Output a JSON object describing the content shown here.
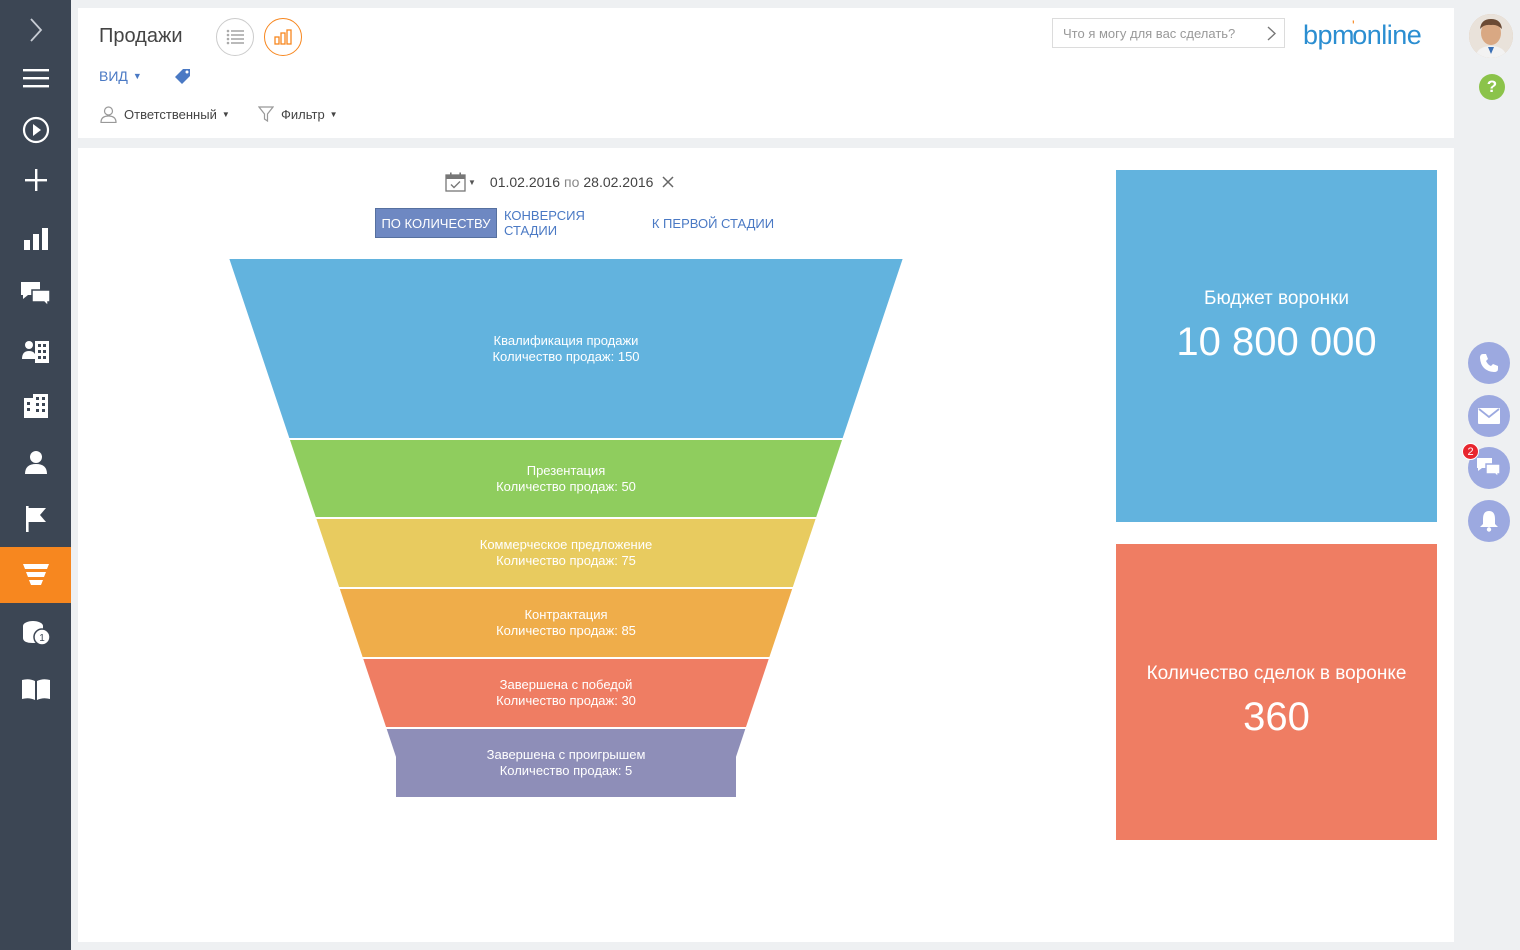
{
  "sidebar": {
    "items": [
      {
        "icon": "chevron-right-icon",
        "active": false
      },
      {
        "icon": "menu-icon",
        "active": false
      },
      {
        "icon": "play-icon",
        "active": false
      },
      {
        "icon": "plus-icon",
        "active": false
      },
      {
        "icon": "bar-chart-icon",
        "active": false
      },
      {
        "icon": "chat-icon",
        "active": false
      },
      {
        "icon": "contacts-icon",
        "active": false
      },
      {
        "icon": "building-icon",
        "active": false
      },
      {
        "icon": "person-icon",
        "active": false
      },
      {
        "icon": "flag-icon",
        "active": false
      },
      {
        "icon": "funnel-icon",
        "active": true
      },
      {
        "icon": "coins-icon",
        "active": false,
        "badge": "1"
      },
      {
        "icon": "book-icon",
        "active": false
      }
    ]
  },
  "header": {
    "title": "Продажи",
    "view_menu": "ВИД",
    "filters": {
      "responsible": "Ответственный",
      "filter": "Фильтр"
    },
    "search_placeholder": "Что я могу для вас сделать?",
    "logo": {
      "part1": "bpm",
      "dot": "'",
      "part2": "online"
    }
  },
  "right_rail": {
    "help": "?",
    "chat_badge": "2"
  },
  "main": {
    "date_from": "01.02.2016",
    "date_sep": "по",
    "date_to": "28.02.2016",
    "tabs": [
      "ПО КОЛИЧЕСТВУ",
      "КОНВЕРСИЯ СТАДИИ",
      "К ПЕРВОЙ СТАДИИ"
    ],
    "active_tab": 0
  },
  "chart_data": {
    "type": "funnel",
    "stages": [
      {
        "name": "Квалификация продажи",
        "label": "Количество продаж: 150",
        "value": 150,
        "color": "#62b3de"
      },
      {
        "name": "Презентация",
        "label": "Количество продаж: 50",
        "value": 50,
        "color": "#8fcd5e"
      },
      {
        "name": "Коммерческое предложение",
        "label": "Количество продаж: 75",
        "value": 75,
        "color": "#e8cb5f"
      },
      {
        "name": "Контрактация",
        "label": "Количество продаж: 85",
        "value": 85,
        "color": "#efad4a"
      },
      {
        "name": "Завершена с победой",
        "label": "Количество продаж: 30",
        "value": 30,
        "color": "#ef7d63"
      },
      {
        "name": "Завершена с проигрышем",
        "label": "Количество продаж: 5",
        "value": 5,
        "color": "#8e8eb8"
      }
    ]
  },
  "kpis": {
    "budget": {
      "title": "Бюджет воронки",
      "value": "10 800 000",
      "color": "#62b3de"
    },
    "deals": {
      "title": "Количество сделок в воронке",
      "value": "360",
      "color": "#ef7d63"
    }
  }
}
